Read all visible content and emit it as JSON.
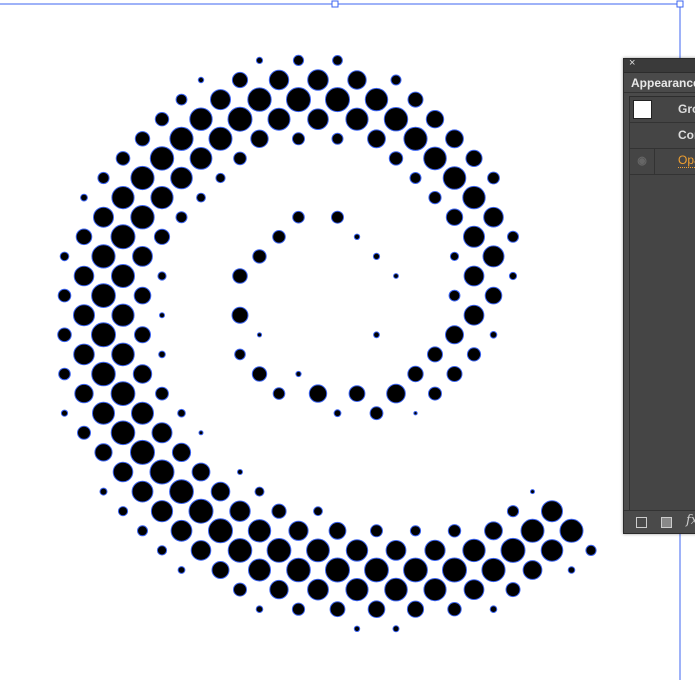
{
  "appearance_panel": {
    "title": "Appearance",
    "close_icon": "close-icon",
    "rows": [
      {
        "label": "Gro",
        "swatch_color": "#ffffff"
      },
      {
        "label": "Con"
      },
      {
        "label": "Opa",
        "color": "#f0a030",
        "visibility_icon": "eye-icon"
      }
    ],
    "footer_icons": [
      "add-new-stroke-icon",
      "add-new-fill-icon",
      "fx-icon"
    ],
    "fx_label": "fx"
  },
  "selection_color": "#3c64f0"
}
